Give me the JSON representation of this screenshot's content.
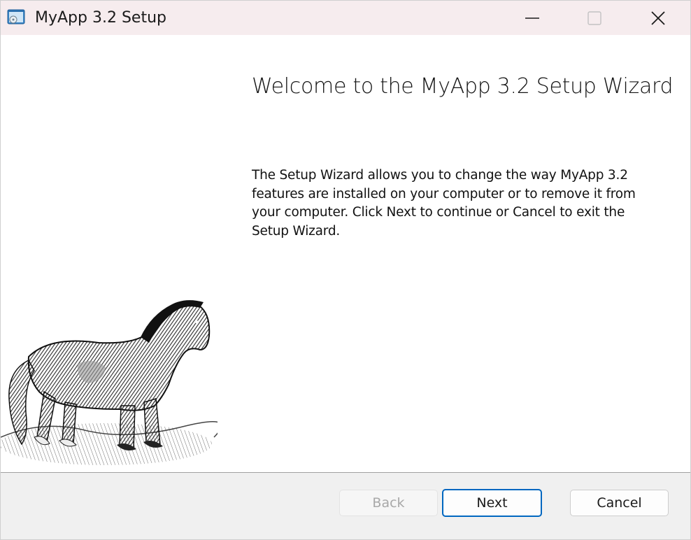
{
  "window": {
    "title": "MyApp 3.2 Setup",
    "accent_color": "#0067c0",
    "titlebar_color": "#f6ecee"
  },
  "titlebar": {
    "app_icon": "installer-icon",
    "minimize_icon": "minimize-icon",
    "maximize_icon": "maximize-icon",
    "close_icon": "close-icon"
  },
  "content": {
    "heading": "Welcome to the MyApp 3.2 Setup Wizard",
    "description": "The Setup Wizard allows you to change the way MyApp 3.2 features are installed on your computer or to remove it from your computer. Click Next to continue or Cancel to exit the Setup Wizard.",
    "side_image": "horse-engraving-illustration"
  },
  "footer": {
    "back_label": "Back",
    "back_enabled": false,
    "next_label": "Next",
    "next_default": true,
    "cancel_label": "Cancel"
  }
}
